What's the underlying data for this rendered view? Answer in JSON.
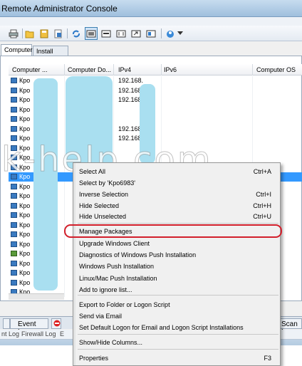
{
  "window": {
    "title": "Remote Administrator Console"
  },
  "toolbar": {
    "icons": [
      "print-icon",
      "folder-open-icon",
      "save-icon",
      "export-icon",
      "refresh-icon",
      "view-client-icon",
      "view-list-icon",
      "view-columns-icon",
      "navigate-icon",
      "view-details-icon",
      "network-icon"
    ]
  },
  "tabs": {
    "computers": "Computers",
    "install_tasks": "Install Tasks"
  },
  "grid": {
    "columns": [
      "Computer ...",
      "Computer Do...",
      "IPv4",
      "IPv6",
      "Computer OS"
    ],
    "rows": [
      {
        "name": "Кро",
        "ip": "192.168."
      },
      {
        "name": "Кро",
        "ip": "192.168."
      },
      {
        "name": "Кро",
        "ip": "192.168."
      },
      {
        "name": "Кро",
        "ip": ""
      },
      {
        "name": "Кро",
        "ip": ""
      },
      {
        "name": "Кро",
        "ip": "192.168."
      },
      {
        "name": "Кро",
        "ip": "192.168."
      },
      {
        "name": "Кро",
        "ip": ""
      },
      {
        "name": "Кро",
        "ip": ""
      },
      {
        "name": "Кро",
        "ip": ""
      },
      {
        "name": "Кро",
        "ip": ""
      },
      {
        "name": "Кро",
        "ip": ""
      },
      {
        "name": "Кро",
        "ip": ""
      },
      {
        "name": "Кро",
        "ip": ""
      },
      {
        "name": "Кро",
        "ip": ""
      },
      {
        "name": "Кро",
        "ip": ""
      },
      {
        "name": "Кро",
        "ip": ""
      },
      {
        "name": "Кро",
        "ip": ""
      },
      {
        "name": "Кро",
        "ip": ""
      },
      {
        "name": "Кро",
        "ip": ""
      },
      {
        "name": "Кро",
        "ip": ""
      },
      {
        "name": "Кро",
        "ip": ""
      },
      {
        "name": "Кро",
        "ip": ""
      }
    ]
  },
  "watermark": "k-help.com",
  "context_menu": {
    "items": [
      {
        "label": "Select All",
        "shortcut": "Ctrl+A"
      },
      {
        "label": "Select by 'Kpo6983'",
        "shortcut": ""
      },
      {
        "label": "Inverse Selection",
        "shortcut": "Ctrl+I"
      },
      {
        "label": "Hide Selected",
        "shortcut": "Ctrl+H"
      },
      {
        "label": "Hide Unselected",
        "shortcut": "Ctrl+U"
      },
      {
        "label": "Manage Packages",
        "shortcut": ""
      },
      {
        "label": "Upgrade Windows Client",
        "shortcut": ""
      },
      {
        "label": "Diagnostics of Windows Push Installation",
        "shortcut": ""
      },
      {
        "label": "Windows Push Installation",
        "shortcut": ""
      },
      {
        "label": "Linux/Mac Push Installation",
        "shortcut": ""
      },
      {
        "label": "Add to ignore list...",
        "shortcut": ""
      },
      {
        "label": "Export to Folder or Logon Script",
        "shortcut": ""
      },
      {
        "label": "Send via Email",
        "shortcut": ""
      },
      {
        "label": "Set Default Logon for Email and Logon Script Installations",
        "shortcut": ""
      },
      {
        "label": "Show/Hide Columns...",
        "shortcut": ""
      },
      {
        "label": "Properties",
        "shortcut": "F3"
      }
    ]
  },
  "bottom_tabs": {
    "event_log": "Event Log",
    "scan_log": "Scan Lo"
  },
  "sub_tabs": {
    "t1": "nt Log",
    "t2": "Firewall Log",
    "t3": "E"
  },
  "colors": {
    "selection": "#3399ff",
    "highlight_ring": "#d21f2b",
    "redaction": "#a9dff0"
  }
}
